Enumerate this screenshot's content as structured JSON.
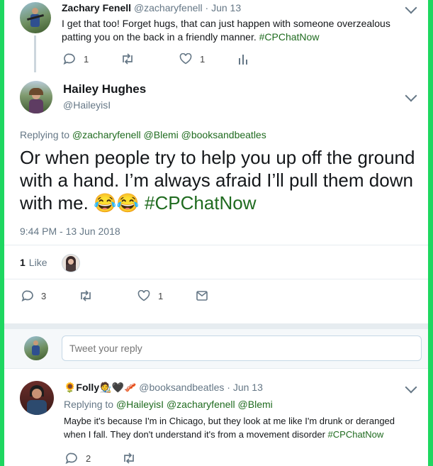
{
  "tweet1": {
    "name": "Zachary Fenell",
    "handle": "@zacharyfenell",
    "dot": "·",
    "date": "Jun 13",
    "text": "I get that too! Forget hugs, that can just happen with someone overzealous patting you on the back in a friendly manner.",
    "hashtag": "#CPChatNow",
    "replies": "1",
    "likes": "1"
  },
  "main": {
    "name": "Hailey Hughes",
    "handle": "@HaileyisI",
    "replying_label": "Replying to",
    "replying_to": [
      "@zacharyfenell",
      "@Blemi",
      "@booksandbeatles"
    ],
    "text": "Or when people try to help you up off the ground with a hand. I’m always afraid I’ll pull them down with me. 😂😂",
    "hashtag": "#CPChatNow",
    "timestamp": "9:44 PM - 13 Jun 2018",
    "like_count": "1",
    "like_label": "Like",
    "replies": "3",
    "likes": "1"
  },
  "composer": {
    "placeholder": "Tweet your reply"
  },
  "tweet3": {
    "name": "🌻Folly🧑‍🎨🖤🥓",
    "handle": "@booksandbeatles",
    "dot": "·",
    "date": "Jun 13",
    "replying_label": "Replying to",
    "replying_to": [
      "@HaileyisI",
      "@zacharyfenell",
      "@Blemi"
    ],
    "text": "Maybe it's because I'm in Chicago, but they look at me like I'm drunk or deranged when I fall. They don't understand it's from a movement disorder",
    "hashtag": "#CPChatNow",
    "replies": "2"
  },
  "colors": {
    "border": "#1ed760",
    "link": "#1f6b1f",
    "muted": "#657786"
  }
}
